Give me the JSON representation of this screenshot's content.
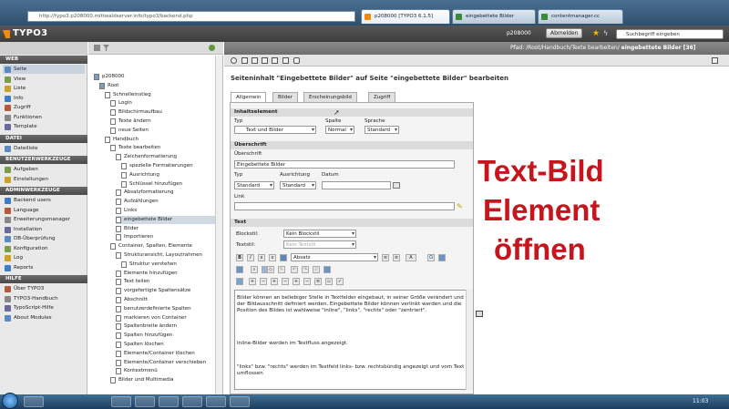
{
  "browser": {
    "url": "http://typo3.p208000.mittwaldserver.info/typo3/backend.php",
    "tabs": [
      {
        "label": "p208000 [TYPO3 6.1.5]",
        "active": true
      },
      {
        "label": "eingebettete Bilder",
        "active": false
      },
      {
        "label": "contentmanager.cc",
        "active": false
      }
    ]
  },
  "topbar": {
    "logo": "TYPO3",
    "user": "p208000",
    "logout": "Abmelden",
    "search_placeholder": "Suchbegriff eingeben"
  },
  "modules": {
    "groups": [
      {
        "label": "WEB",
        "items": [
          "Seite",
          "View",
          "Liste",
          "Info",
          "Zugriff",
          "Funktionen",
          "Template"
        ]
      },
      {
        "label": "DATEI",
        "items": [
          "Dateiliste"
        ]
      },
      {
        "label": "BENUTZERWERKZEUGE",
        "items": [
          "Aufgaben",
          "Einstellungen"
        ]
      },
      {
        "label": "ADMINWERKZEUGE",
        "items": [
          "Backend users",
          "Language",
          "Erweiterungsmanager",
          "Installation",
          "DB-Überprüfung",
          "Konfiguration",
          "Log",
          "Reports"
        ]
      },
      {
        "label": "HILFE",
        "items": [
          "Über TYPO3",
          "TYPO3-Handbuch",
          "TypoScript-Hilfe",
          "About Modules"
        ]
      }
    ]
  },
  "tree": {
    "nodes": [
      {
        "label": "p208000",
        "level": 0
      },
      {
        "label": "Root",
        "level": 1
      },
      {
        "label": "Schnelleinstieg",
        "level": 2
      },
      {
        "label": "Login",
        "level": 3
      },
      {
        "label": "Bildschirmaufbau",
        "level": 3
      },
      {
        "label": "Texte ändern",
        "level": 3
      },
      {
        "label": "neue Seiten",
        "level": 3
      },
      {
        "label": "Handbuch",
        "level": 2
      },
      {
        "label": "Texte bearbeiten",
        "level": 3
      },
      {
        "label": "Zeichenformatierung",
        "level": 4
      },
      {
        "label": "spezielle Formatierungen",
        "level": 5
      },
      {
        "label": "Ausrichtung",
        "level": 5
      },
      {
        "label": "Schlüssel hinzufügen",
        "level": 5
      },
      {
        "label": "Absatzformatierung",
        "level": 4
      },
      {
        "label": "Aufzählungen",
        "level": 4
      },
      {
        "label": "Links",
        "level": 4
      },
      {
        "label": "eingebettete Bilder",
        "level": 4,
        "selected": true
      },
      {
        "label": "Bilder",
        "level": 4
      },
      {
        "label": "Importieren",
        "level": 4
      },
      {
        "label": "Container, Spalten, Elemente",
        "level": 3
      },
      {
        "label": "Strukturansicht, Layoutrahmen",
        "level": 4
      },
      {
        "label": "Struktur verstehen",
        "level": 5
      },
      {
        "label": "Elemente hinzufügen",
        "level": 4
      },
      {
        "label": "Text teilen",
        "level": 4
      },
      {
        "label": "vorgefertigte Spaltensätze",
        "level": 4
      },
      {
        "label": "Abschnitt",
        "level": 4
      },
      {
        "label": "benutzerdefinierte Spalten",
        "level": 4
      },
      {
        "label": "markieren von Container",
        "level": 4
      },
      {
        "label": "Spaltenbreite ändern",
        "level": 4
      },
      {
        "label": "Spalten hinzufügen",
        "level": 4
      },
      {
        "label": "Spalten löschen",
        "level": 4
      },
      {
        "label": "Elemente/Container löschen",
        "level": 4
      },
      {
        "label": "Elemente/Container verschieben",
        "level": 4
      },
      {
        "label": "Kontextmenü",
        "level": 4
      },
      {
        "label": "Bilder und Multimedia",
        "level": 3
      }
    ]
  },
  "content": {
    "breadcrumb": "Pfad: /Root/Handbuch/Texte bearbeiten/",
    "page_label": "eingebettete Bilder [36]",
    "title": "Seiteninhalt \"Eingebettete Bilder\" auf Seite \"eingebettete Bilder\" bearbeiten",
    "tabs": [
      "Allgemein",
      "Bilder",
      "Erscheinungsbild",
      "Zugriff"
    ],
    "sections": {
      "inhaltselement": "Inhaltselement",
      "ueberschrift": "Überschrift",
      "text": "Text"
    },
    "fields": {
      "typ_label": "Typ",
      "typ_value": "Text und Bilder",
      "spalte_label": "Spalte",
      "spalte_value": "Normal",
      "sprache_label": "Sprache",
      "sprache_value": "Standard",
      "ueberschrift_label": "Überschrift",
      "ueberschrift_value": "Eingebettete Bilder",
      "h_typ_label": "Typ",
      "h_typ_value": "Standard",
      "ausrichtung_label": "Ausrichtung",
      "ausrichtung_value": "Standard",
      "datum_label": "Datum",
      "link_label": "Link",
      "blockstil_label": "Blockstil:",
      "blockstil_value": "Kein Blockstil",
      "textstil_label": "Textstil:",
      "textstil_value": "Kein Textstil",
      "absatz_value": "Absatz"
    },
    "rte_paragraphs": [
      "Bilder können an beliebiger Stelle in Textfelder eingebaut, in seiner Größe verändert und der Bildausschnitt definiert werden. Eingebettete Bilder können verlinkt werden und die Position des Bildes ist wahlweise \"inline\", \"links\", \"rechts\" oder \"zentriert\".",
      "Inline-Bilder werden im Textfluss angezeigt.",
      "\"links\" bzw. \"rechts\" werden im Textfeld links- bzw. rechtsbündig angezeigt und vom Text umflossen"
    ]
  },
  "overlay": {
    "lines": [
      "Text-Bild",
      "Element",
      "öffnen"
    ],
    "color": "#c4161c"
  },
  "taskbar": {
    "clock": "11:03"
  }
}
